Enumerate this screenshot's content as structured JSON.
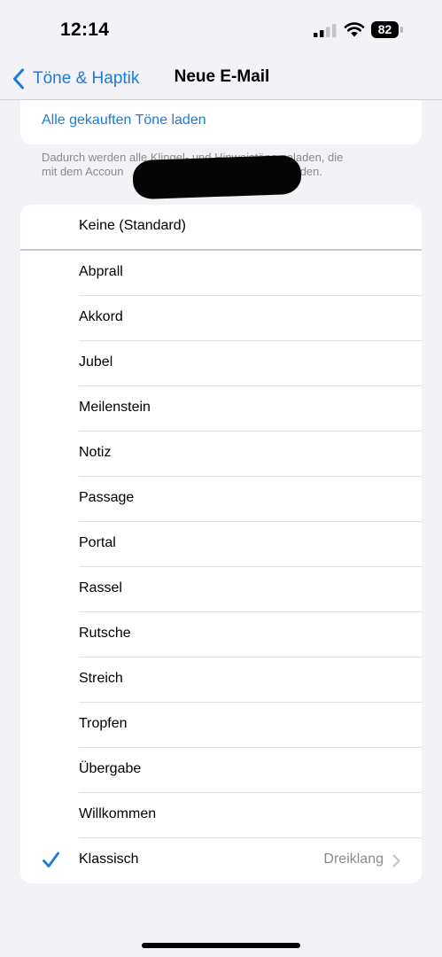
{
  "status_bar": {
    "time": "12:14",
    "battery": "82"
  },
  "nav": {
    "back_label": "Töne & Haptik",
    "title": "Neue E-Mail"
  },
  "download": {
    "link_label": "Alle gekauften Töne laden",
    "footnote_line1": "Dadurch werden alle Klingel- und Hinweistöne geladen, die",
    "footnote_line2": "mit dem Accoun",
    "footnote_line2_end": "gekauft wurden."
  },
  "tones": {
    "none_option": "Keine (Standard)",
    "items": [
      "Abprall",
      "Akkord",
      "Jubel",
      "Meilenstein",
      "Notiz",
      "Passage",
      "Portal",
      "Rassel",
      "Rutsche",
      "Streich",
      "Tropfen",
      "Übergabe",
      "Willkommen"
    ],
    "classic": {
      "label": "Klassisch",
      "value": "Dreiklang",
      "selected": true
    }
  },
  "colors": {
    "accent": "#1a7bd8",
    "background": "#f2f2f7",
    "secondary_text": "#8a8a8e"
  },
  "icons": {
    "back": "chevron-left-icon",
    "selected": "checkmark-icon",
    "disclosure": "chevron-right-icon",
    "signal": "cellular-signal-icon",
    "wifi": "wifi-icon",
    "battery": "battery-icon"
  }
}
